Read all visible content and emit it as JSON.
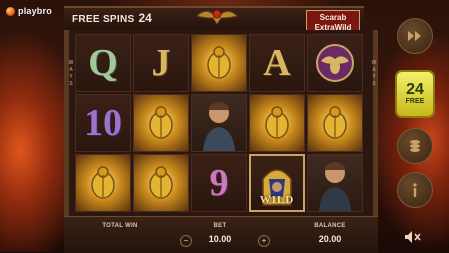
{
  "app": {
    "logo_text": "playbro"
  },
  "header": {
    "free_spins_label": "FREE SPINS",
    "free_spins_count": "24",
    "wild_box_line1": "Scarab",
    "wild_box_line2": "ExtraWild"
  },
  "reels": {
    "ways_left": [
      "W",
      "A",
      "Y",
      "S"
    ],
    "ways_right": [
      "W",
      "A",
      "Y",
      "S"
    ],
    "wild_label": "WILD",
    "symbols": [
      [
        "Q",
        "J",
        "scarab-wild",
        "A",
        "scarab-emblem"
      ],
      [
        "10",
        "scarab-wild",
        "explorer-man",
        "scarab-wild",
        "scarab-wild"
      ],
      [
        "scarab-wild",
        "scarab-wild",
        "9",
        "pharaoh-wild",
        "explorer-man"
      ]
    ],
    "symbol_letters": {
      "q": "Q",
      "j": "J",
      "a": "A",
      "ten": "10",
      "nine": "9"
    }
  },
  "footer": {
    "total_win_label": "TOTAL WIN",
    "bet_label": "BET",
    "bet_value": "10.00",
    "balance_label": "BALANCE",
    "balance_value": "20.00",
    "minus": "−",
    "plus": "+"
  },
  "side": {
    "free_spins_count": "24",
    "free_label": "FREE",
    "icons": [
      "fast-forward-icon",
      "free-spins-button",
      "coin-stack-icon",
      "info-icon",
      "sound-off-icon"
    ]
  },
  "colors": {
    "accent_gold": "#d8b763",
    "wild_red": "#7b1710",
    "free_spins_yellow": "#f4f06a"
  }
}
